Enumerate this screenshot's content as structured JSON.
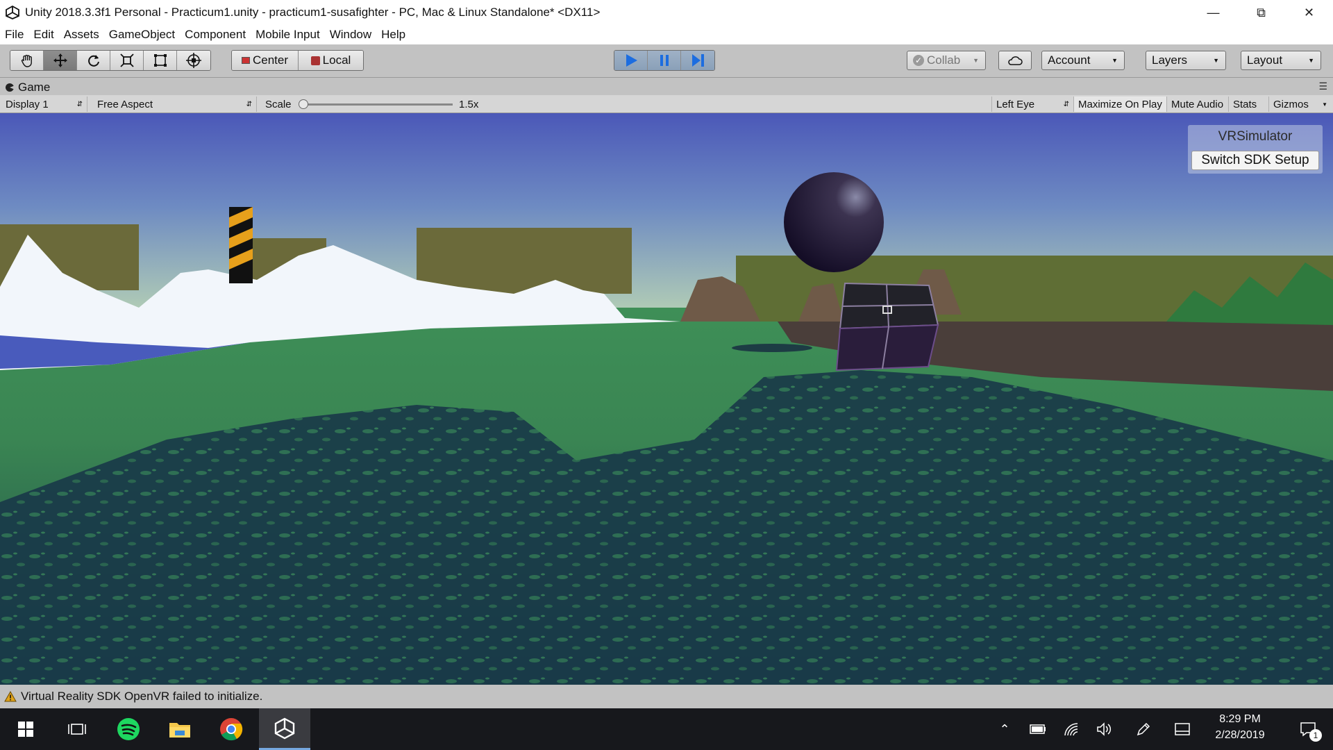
{
  "window": {
    "title": "Unity 2018.3.3f1 Personal - Practicum1.unity - practicum1-susafighter - PC, Mac & Linux Standalone* <DX11>"
  },
  "menu": [
    "File",
    "Edit",
    "Assets",
    "GameObject",
    "Component",
    "Mobile Input",
    "Window",
    "Help"
  ],
  "toolbar": {
    "tools": [
      "hand-icon",
      "move-icon",
      "rotate-icon",
      "scale-icon",
      "rect-icon",
      "transform-icon"
    ],
    "pivot_center": "Center",
    "pivot_local": "Local",
    "collab": "Collab",
    "account": "Account",
    "layers": "Layers",
    "layout": "Layout"
  },
  "game_tab": {
    "label": "Game"
  },
  "game_bar": {
    "display": "Display 1",
    "aspect": "Free Aspect",
    "scale_label": "Scale",
    "scale_value": "1.5x",
    "eye": "Left Eye",
    "maximize": "Maximize On Play",
    "mute": "Mute Audio",
    "stats": "Stats",
    "gizmos": "Gizmos"
  },
  "vr_simulator": {
    "title": "VRSimulator",
    "button": "Switch SDK Setup"
  },
  "status": {
    "message": "Virtual Reality SDK OpenVR failed to initialize."
  },
  "taskbar": {
    "time": "8:29 PM",
    "date": "2/28/2019",
    "notifications": "1"
  },
  "colors": {
    "play_active": "#1c6de0",
    "ground": "#3b8a52",
    "sky_top": "#4b58b8",
    "sky_horizon": "#b8d3b4"
  }
}
